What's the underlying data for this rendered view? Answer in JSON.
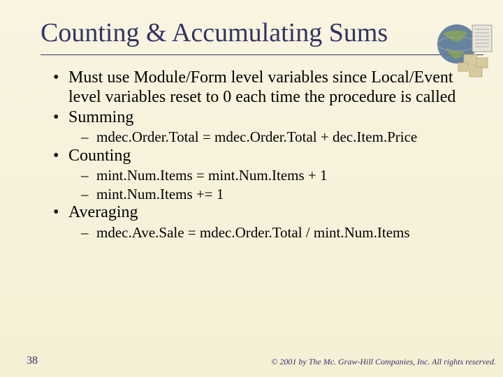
{
  "title": "Counting & Accumulating Sums",
  "bullets": {
    "b1": "Must use Module/Form level variables since Local/Event level variables reset to 0 each time the procedure is called",
    "b2": "Summing",
    "b2a": "mdec.Order.Total = mdec.Order.Total + dec.Item.Price",
    "b3": "Counting",
    "b3a": "mint.Num.Items = mint.Num.Items + 1",
    "b3b": "mint.Num.Items += 1",
    "b4": "Averaging",
    "b4a": "mdec.Ave.Sale = mdec.Order.Total / mint.Num.Items"
  },
  "page": "38",
  "copyright": "© 2001 by The Mc. Graw-Hill Companies, Inc. All rights reserved."
}
